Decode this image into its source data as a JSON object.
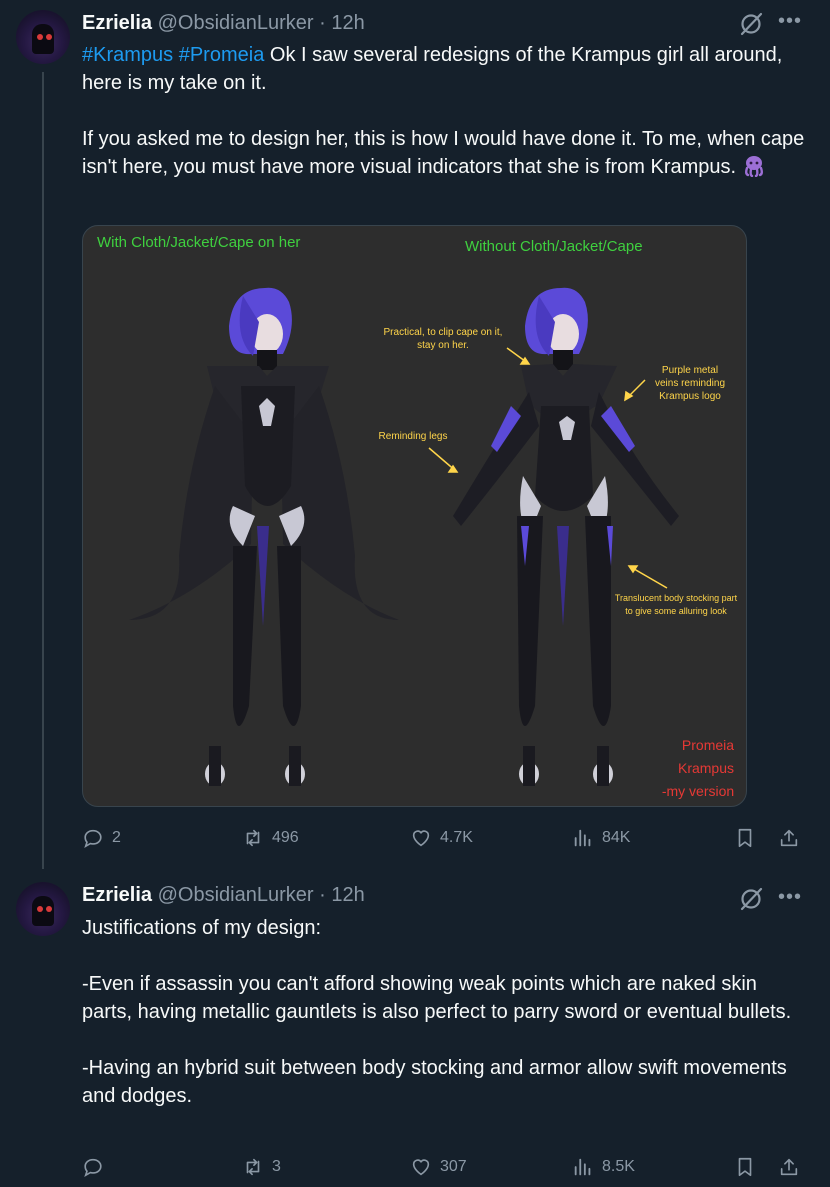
{
  "tweets": [
    {
      "name": "Ezrielia",
      "handle": "@ObsidianLurker",
      "separator": " · ",
      "time": "12h",
      "hashtags": [
        "#Krampus",
        "#Promeia"
      ],
      "text_line1": " Ok I saw several redesigns of the Krampus girl all around, here is my take on it.",
      "text_para2": "If you asked me to design her, this is how I would have done it. To me, when cape isn't here, you must have more visual indicators that she is from Krampus.",
      "emoji": "octopus-emoji",
      "media": {
        "label_left": "With Cloth/Jacket/Cape on her",
        "label_right": "Without Cloth/Jacket/Cape",
        "note_clip": "Practical, to clip cape on it, stay on her.",
        "note_veins": "Purple metal veins reminding Krampus logo",
        "note_legs": "Reminding legs",
        "note_stocking": "Translucent body stocking part to give some alluring look",
        "signature_1": "Promeia",
        "signature_2": "Krampus",
        "signature_3": "-my version"
      },
      "stats": {
        "replies": "2",
        "reposts": "496",
        "likes": "4.7K",
        "views": "84K"
      }
    },
    {
      "name": "Ezrielia",
      "handle": "@ObsidianLurker",
      "separator": " · ",
      "time": "12h",
      "para1": "Justifications of my design:",
      "para2": "-Even if assassin you can't afford showing weak points which are naked skin parts, having metallic gauntlets is also perfect to parry sword or eventual bullets.",
      "para3": "-Having an hybrid suit between body stocking and armor allow swift movements and dodges.",
      "stats": {
        "replies": "",
        "reposts": "3",
        "likes": "307",
        "views": "8.5K"
      }
    }
  ],
  "colors": {
    "background": "#15202b",
    "link": "#1d9bf0",
    "muted": "#8b98a5",
    "text": "#f7f9f9"
  }
}
